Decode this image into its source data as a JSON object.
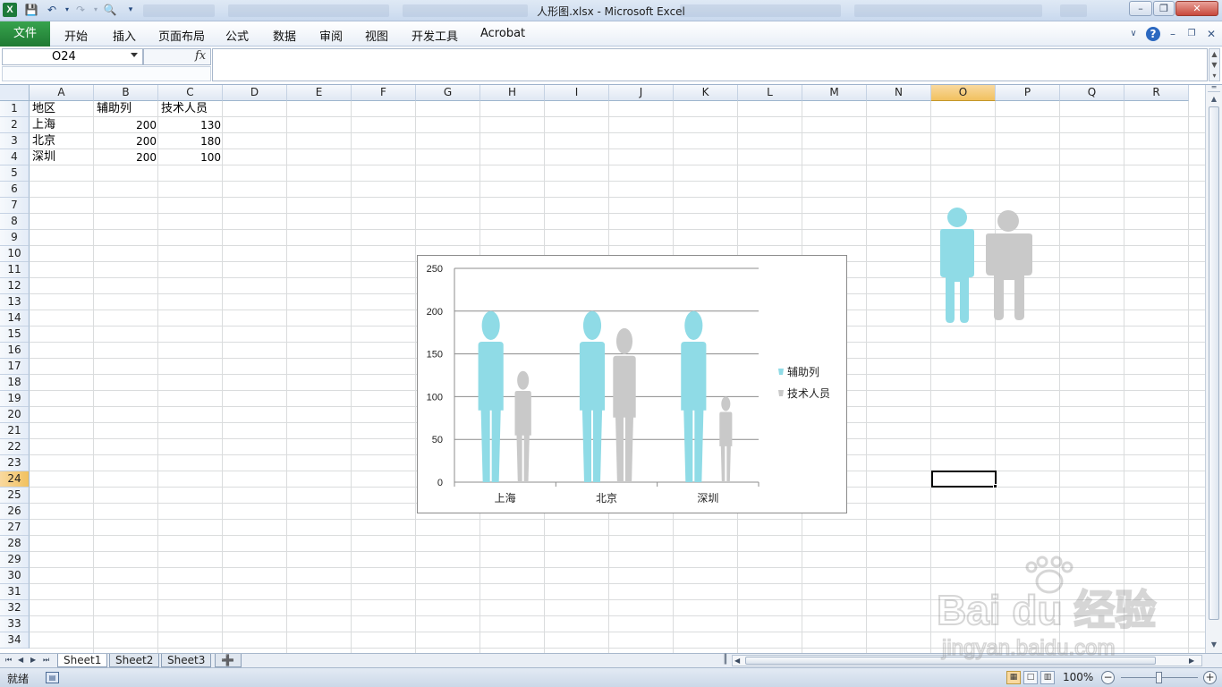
{
  "window": {
    "title": "人形图.xlsx  -  Microsoft Excel"
  },
  "ribbon": {
    "file_tab": "文件",
    "tabs": [
      "开始",
      "插入",
      "页面布局",
      "公式",
      "数据",
      "审阅",
      "视图",
      "开发工具",
      "Acrobat"
    ]
  },
  "formula_bar": {
    "name_box": "O24",
    "fx_label": "fx",
    "formula": ""
  },
  "sheet": {
    "columns": [
      "A",
      "B",
      "C",
      "D",
      "E",
      "F",
      "G",
      "H",
      "I",
      "J",
      "K",
      "L",
      "M",
      "N",
      "O",
      "P",
      "Q",
      "R"
    ],
    "rows": [
      "1",
      "2",
      "3",
      "4",
      "5",
      "6",
      "7",
      "8",
      "9",
      "10",
      "11",
      "12",
      "13",
      "14",
      "15",
      "16",
      "17",
      "18",
      "19",
      "20",
      "21",
      "22",
      "23",
      "24",
      "25",
      "26",
      "27",
      "28",
      "29",
      "30",
      "31",
      "32",
      "33",
      "34"
    ],
    "selected_column": "O",
    "selected_row": "24",
    "cells": {
      "A1": "地区",
      "B1": "辅助列",
      "C1": "技术人员",
      "A2": "上海",
      "B2": "200",
      "C2": "130",
      "A3": "北京",
      "B3": "200",
      "C3": "180",
      "A4": "深圳",
      "B4": "200",
      "C4": "100"
    }
  },
  "chart_data": {
    "type": "bar",
    "categories": [
      "上海",
      "北京",
      "深圳"
    ],
    "series": [
      {
        "name": "辅助列",
        "values": [
          200,
          200,
          200
        ],
        "color": "#8fdbe6"
      },
      {
        "name": "技术人员",
        "values": [
          130,
          180,
          100
        ],
        "color": "#c9c9c9"
      }
    ],
    "title": "",
    "xlabel": "",
    "ylabel": "",
    "ylim": [
      0,
      250
    ],
    "yticks": [
      "0",
      "50",
      "100",
      "150",
      "200",
      "250"
    ],
    "grid": true,
    "legend_position": "right",
    "marker": "person-pictogram"
  },
  "sheet_tabs": [
    "Sheet1",
    "Sheet2",
    "Sheet3"
  ],
  "active_sheet": "Sheet1",
  "status": {
    "ready": "就绪",
    "zoom": "100%"
  },
  "colors": {
    "file_tab": "#1f7a33",
    "selection": "#f1c15f",
    "series_1": "#8fdbe6",
    "series_2": "#c9c9c9"
  },
  "watermark": {
    "brand": "Bai du 经验",
    "url": "jingyan.baidu.com"
  }
}
